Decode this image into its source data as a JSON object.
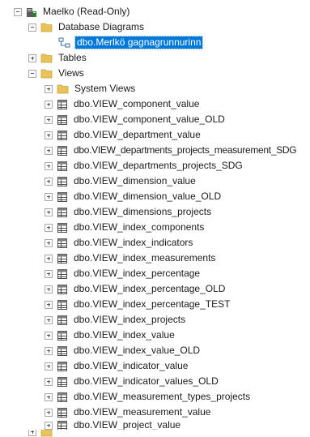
{
  "server_node": {
    "label": "Maelko (Read-Only)",
    "icon": "database-icon"
  },
  "diagrams_folder": {
    "label": "Database Diagrams",
    "icon": "folder-icon"
  },
  "diagram_item": {
    "label": "dbo.Merlkö gagnagrunnurinn",
    "icon": "diagram-icon",
    "selected": true
  },
  "tables_folder": {
    "label": "Tables",
    "icon": "folder-icon"
  },
  "views_folder": {
    "label": "Views",
    "icon": "folder-icon"
  },
  "system_views_folder": {
    "label": "System Views",
    "icon": "folder-icon"
  },
  "views": [
    "dbo.VIEW_component_value",
    "dbo.VIEW_component_value_OLD",
    "dbo.VIEW_department_value",
    "dbo.VIEW_departments_projects_measurement_SDG",
    "dbo.VIEW_departments_projects_SDG",
    "dbo.VIEW_dimension_value",
    "dbo.VIEW_dimension_value_OLD",
    "dbo.VIEW_dimensions_projects",
    "dbo.VIEW_index_components",
    "dbo.VIEW_index_indicators",
    "dbo.VIEW_index_measurements",
    "dbo.VIEW_index_percentage",
    "dbo.VIEW_index_percentage_OLD",
    "dbo.VIEW_index_percentage_TEST",
    "dbo.VIEW_index_projects",
    "dbo.VIEW_index_value",
    "dbo.VIEW_index_value_OLD",
    "dbo.VIEW_indicator_value",
    "dbo.VIEW_indicator_values_OLD",
    "dbo.VIEW_measurement_types_projects",
    "dbo.VIEW_measurement_value",
    "dbo.VIEW_project_value"
  ],
  "colors": {
    "selection": "#0078d7",
    "folder": "#e8c35a",
    "view_icon": "#4a4a4a"
  }
}
